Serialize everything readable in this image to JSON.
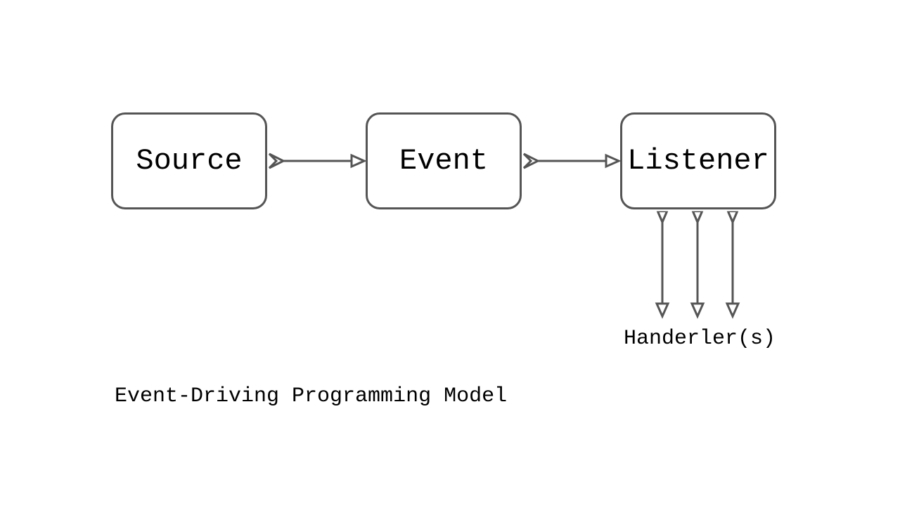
{
  "boxes": {
    "source": "Source",
    "event": "Event",
    "listener": "Listener"
  },
  "labels": {
    "handlers": "Handerler(s)"
  },
  "caption": "Event-Driving Programming Model",
  "colors": {
    "stroke": "#555555",
    "fill": "#ffffff",
    "text": "#000000"
  }
}
